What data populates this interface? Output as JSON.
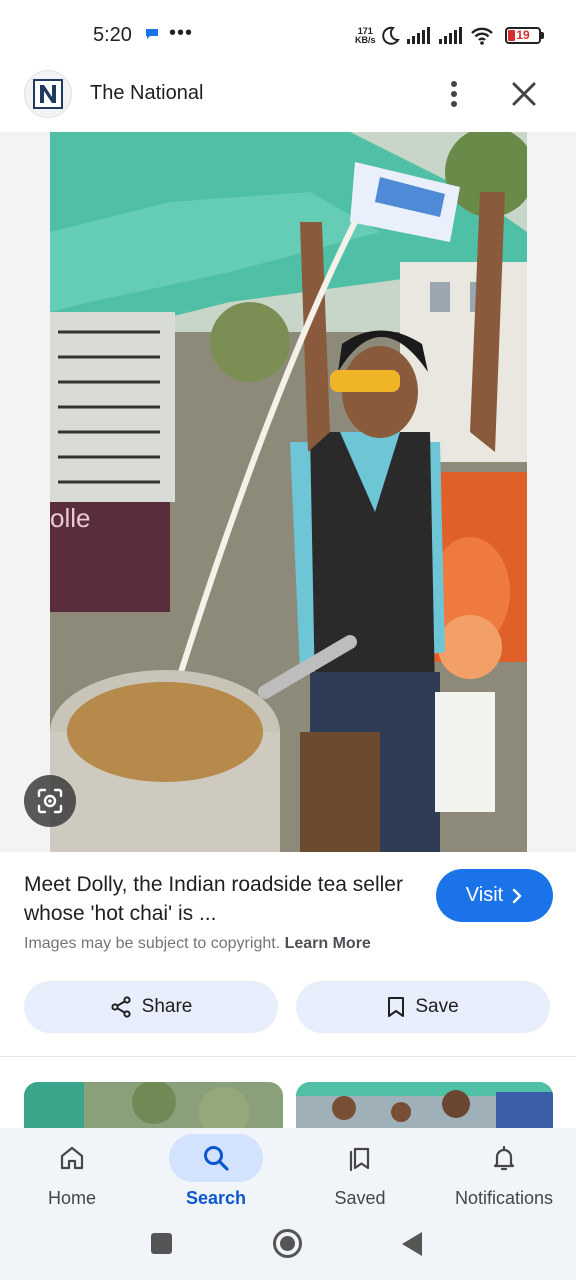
{
  "status_bar": {
    "time": "5:20",
    "dots": "•••",
    "net_speed_value": "171",
    "net_speed_unit": "KB/s",
    "battery": "19"
  },
  "header": {
    "site_title": "The National",
    "logo_letter": "N"
  },
  "result": {
    "title": "Meet Dolly, the Indian roadside tea seller whose 'hot chai' is ...",
    "visit_label": "Visit",
    "copyright_text": "Images may be subject to copyright.",
    "learn_more": "Learn More",
    "share_label": "Share",
    "save_label": "Save"
  },
  "bottom_nav": {
    "items": [
      {
        "label": "Home",
        "icon": "home-icon"
      },
      {
        "label": "Search",
        "icon": "search-icon",
        "active": true
      },
      {
        "label": "Saved",
        "icon": "saved-icon"
      },
      {
        "label": "Notifications",
        "icon": "bell-icon"
      }
    ]
  },
  "colors": {
    "accent": "#1a73e8",
    "active_nav": "#0b57d0",
    "nav_pill": "#d3e3fd",
    "action_button_bg": "#e8eefb",
    "battery_low": "#d32f2f"
  }
}
